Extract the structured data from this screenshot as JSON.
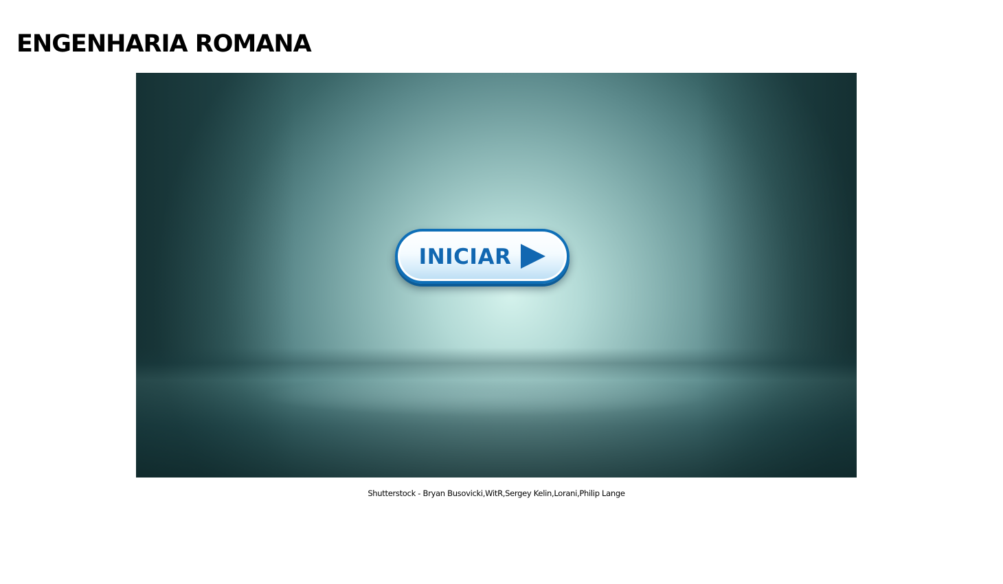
{
  "page": {
    "title": "ENGENHARIA ROMANA"
  },
  "stage": {
    "start_button_label": "INICIAR",
    "start_button_icon": "play-icon",
    "colors": {
      "button_text": "#1167b1",
      "button_border": "#0f6fb7",
      "background_center": "#d4f2ec",
      "background_edge": "#244a4d"
    }
  },
  "credit": {
    "text": "Shutterstock - Bryan Busovicki,WitR,Sergey Kelin,Lorani,Philip Lange"
  }
}
